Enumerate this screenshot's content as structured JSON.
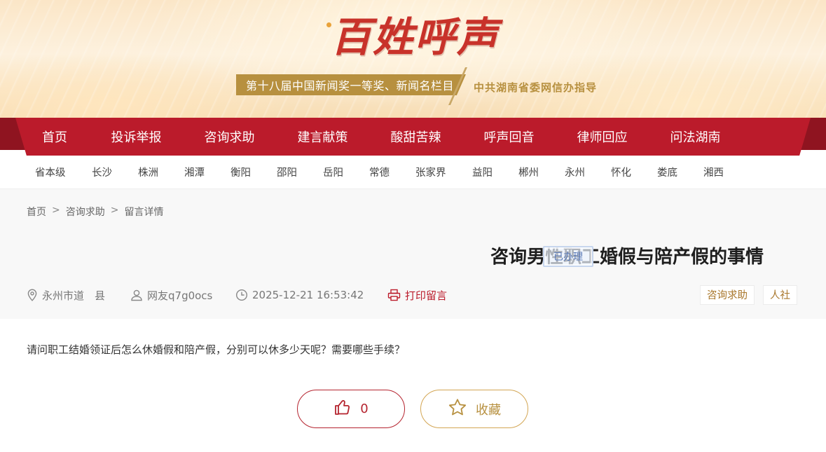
{
  "banner": {
    "logo_text": "百姓呼声",
    "award": "第十八届中国新闻奖一等奖、新闻名栏目",
    "guide": "中共湖南省委网信办指导"
  },
  "nav": {
    "items": [
      "首页",
      "投诉举报",
      "咨询求助",
      "建言献策",
      "酸甜苦辣",
      "呼声回音",
      "律师回应",
      "问法湖南"
    ]
  },
  "regions": [
    "省本级",
    "长沙",
    "株洲",
    "湘潭",
    "衡阳",
    "邵阳",
    "岳阳",
    "常德",
    "张家界",
    "益阳",
    "郴州",
    "永州",
    "怀化",
    "娄底",
    "湘西"
  ],
  "breadcrumb": [
    "首页",
    "咨询求助",
    "留言详情"
  ],
  "breadcrumb_sep": ">",
  "post": {
    "title": "咨询男性职工婚假与陪产假的事情",
    "status": "已办理",
    "location": "永州市道　县",
    "author": "网友q7g0ocs",
    "datetime": "2025-12-21 16:53:42",
    "print_label": "打印留言",
    "tags": [
      "咨询求助",
      "人社"
    ],
    "content": "请问职工结婚领证后怎么休婚假和陪产假，分别可以休多少天呢？需要哪些手续？"
  },
  "actions": {
    "like_count": "0",
    "favorite_label": "收藏"
  },
  "icons": {
    "location": "map-pin-icon",
    "author": "user-icon",
    "time": "clock-icon",
    "print": "printer-icon",
    "like": "thumbs-up-icon",
    "favorite": "star-icon"
  },
  "colors": {
    "brand_red": "#bb1b2b",
    "nav_dark": "#8f1420",
    "gold": "#b7903f",
    "status_blue": "#5a7ab8"
  }
}
